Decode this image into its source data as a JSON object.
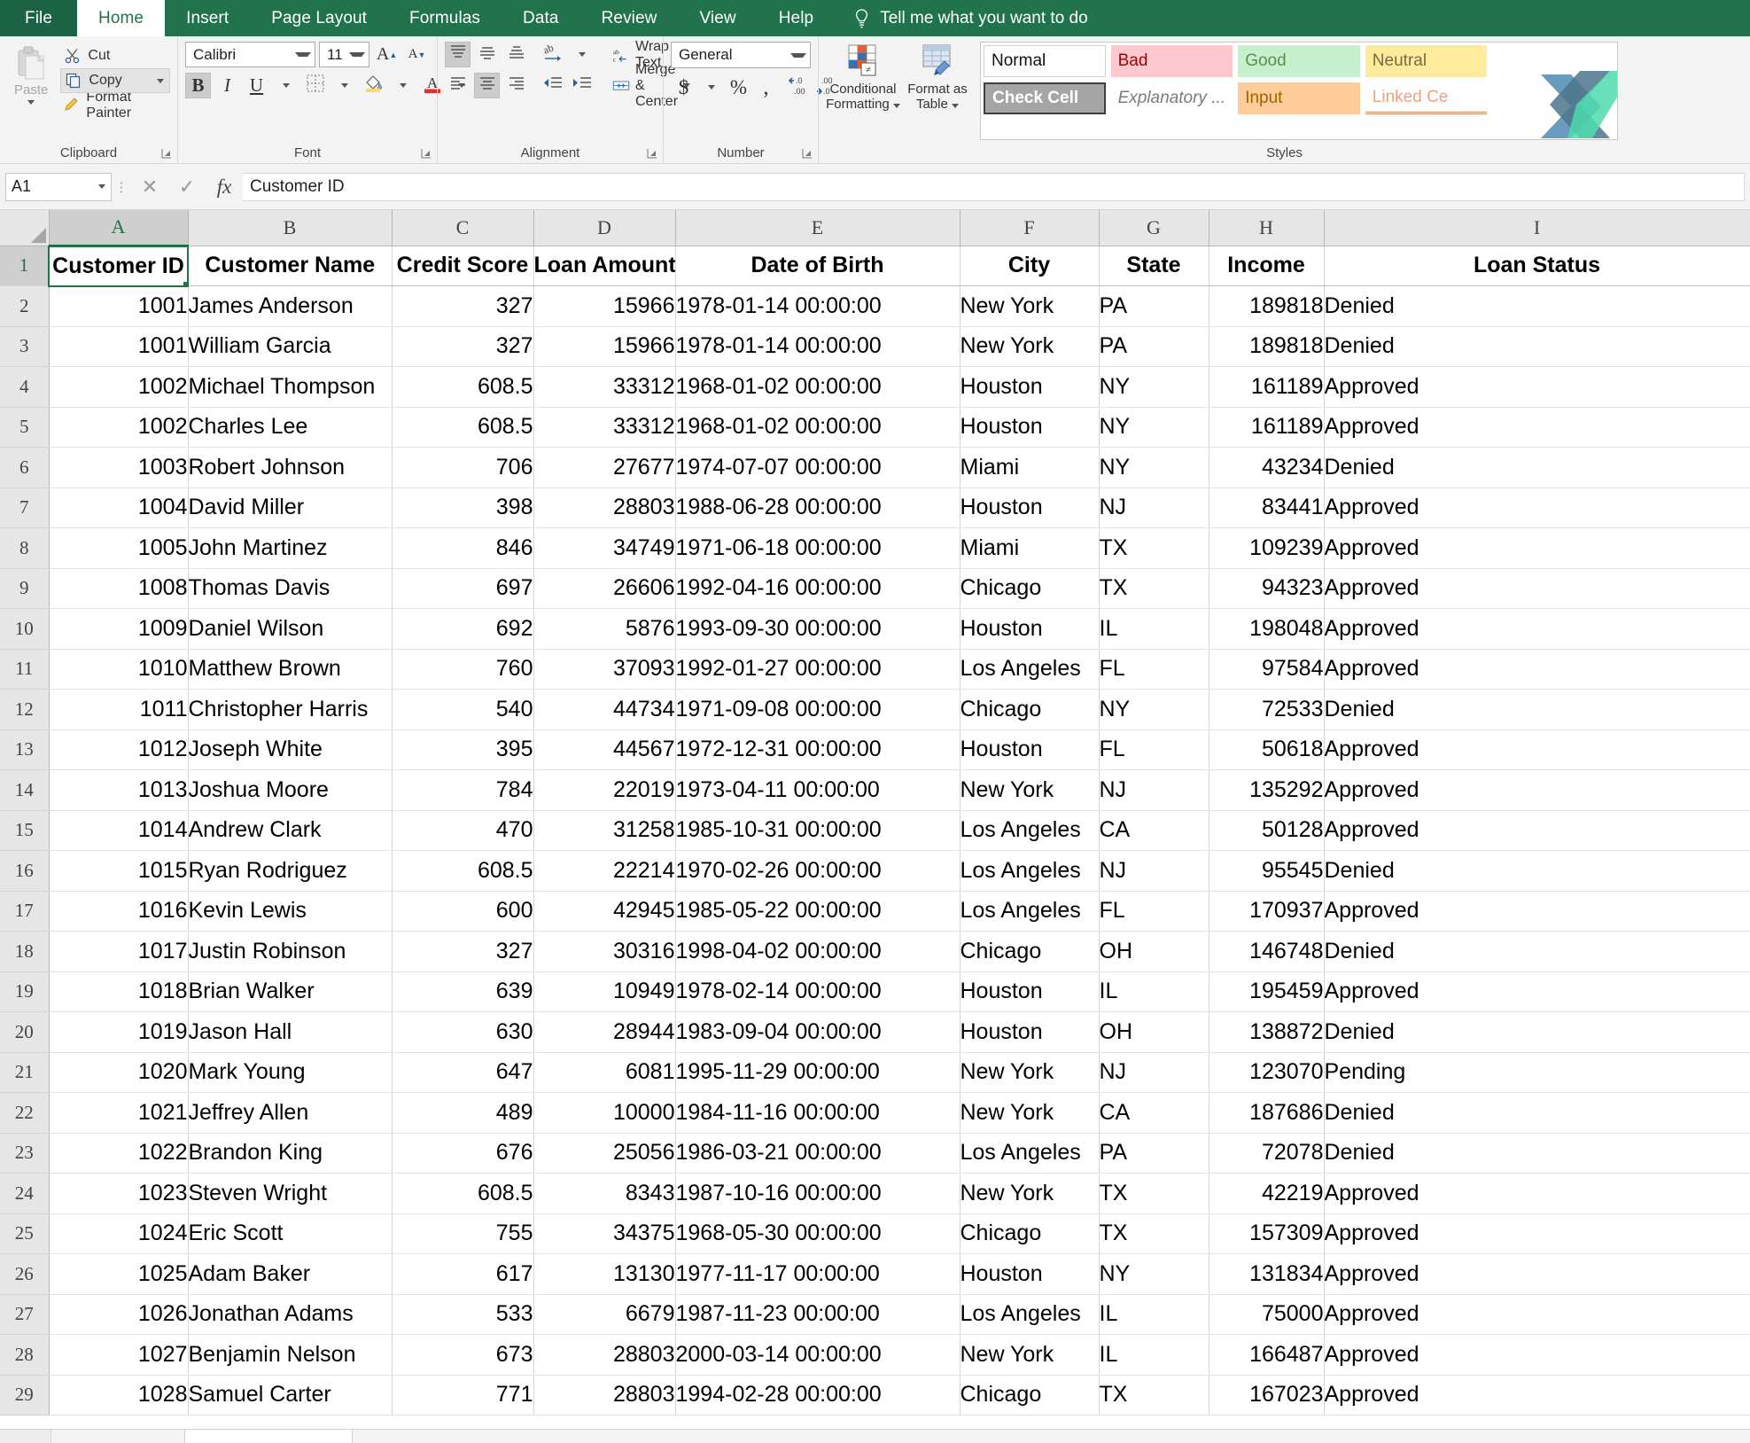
{
  "ribbon": {
    "tabs": [
      {
        "label": "File",
        "id": "file"
      },
      {
        "label": "Home",
        "id": "home"
      },
      {
        "label": "Insert",
        "id": "insert"
      },
      {
        "label": "Page Layout",
        "id": "page-layout"
      },
      {
        "label": "Formulas",
        "id": "formulas"
      },
      {
        "label": "Data",
        "id": "data"
      },
      {
        "label": "Review",
        "id": "review"
      },
      {
        "label": "View",
        "id": "view"
      },
      {
        "label": "Help",
        "id": "help"
      }
    ],
    "tell_me": "Tell me what you want to do",
    "groups": {
      "clipboard": {
        "label": "Clipboard",
        "paste": "Paste",
        "cut": "Cut",
        "copy": "Copy",
        "format_painter": "Format Painter"
      },
      "font": {
        "label": "Font",
        "font_name": "Calibri",
        "font_size": "11",
        "bold": "B",
        "italic": "I",
        "underline": "U"
      },
      "alignment": {
        "label": "Alignment",
        "wrap_text": "Wrap Text",
        "merge_center": "Merge & Center"
      },
      "number": {
        "label": "Number",
        "format": "General",
        "currency": "$",
        "percent": "%",
        "comma": ",",
        "increase_decimal": ".00",
        "decrease_decimal": ".00"
      },
      "styles": {
        "label": "Styles",
        "conditional_formatting": "Conditional Formatting",
        "format_as_table": "Format as Table",
        "gallery": [
          "Normal",
          "Bad",
          "Good",
          "Neutral",
          "",
          "Check Cell",
          "Explanatory ...",
          "Input",
          "Linked Ce",
          ""
        ],
        "gallery_items": {
          "normal": "Normal",
          "bad": "Bad",
          "good": "Good",
          "neutral": "Neutral",
          "check_cell": "Check Cell",
          "explanatory": "Explanatory ...",
          "input": "Input",
          "linked_cell": "Linked Ce"
        }
      }
    }
  },
  "formula_bar": {
    "name_box": "A1",
    "cancel": "✕",
    "enter": "✓",
    "fx": "fx",
    "content": "Customer ID"
  },
  "sheet": {
    "column_letters": [
      "A",
      "B",
      "C",
      "D",
      "E",
      "F",
      "G",
      "H",
      "I"
    ],
    "selected_column": "A",
    "selected_row": 1,
    "active_cell": "A1",
    "row_numbers": [
      1,
      2,
      3,
      4,
      5,
      6,
      7,
      8,
      9,
      10,
      11,
      12,
      13,
      14,
      15,
      16,
      17,
      18,
      19,
      20,
      21,
      22,
      23,
      24,
      25,
      26,
      27,
      28,
      29
    ],
    "headers": [
      "Customer ID",
      "Customer Name",
      "Credit Score",
      "Loan Amount",
      "Date of Birth",
      "City",
      "State",
      "Income",
      "Loan Status"
    ],
    "rows": [
      [
        "1001",
        "James Anderson",
        "327",
        "15966",
        "1978-01-14 00:00:00",
        "New York",
        "PA",
        "189818",
        "Denied"
      ],
      [
        "1001",
        "William Garcia",
        "327",
        "15966",
        "1978-01-14 00:00:00",
        "New York",
        "PA",
        "189818",
        "Denied"
      ],
      [
        "1002",
        "Michael Thompson",
        "608.5",
        "33312",
        "1968-01-02 00:00:00",
        "Houston",
        "NY",
        "161189",
        "Approved"
      ],
      [
        "1002",
        "Charles Lee",
        "608.5",
        "33312",
        "1968-01-02 00:00:00",
        "Houston",
        "NY",
        "161189",
        "Approved"
      ],
      [
        "1003",
        "Robert Johnson",
        "706",
        "27677",
        "1974-07-07 00:00:00",
        "Miami",
        "NY",
        "43234",
        "Denied"
      ],
      [
        "1004",
        "David Miller",
        "398",
        "28803",
        "1988-06-28 00:00:00",
        "Houston",
        "NJ",
        "83441",
        "Approved"
      ],
      [
        "1005",
        "John Martinez",
        "846",
        "34749",
        "1971-06-18 00:00:00",
        "Miami",
        "TX",
        "109239",
        "Approved"
      ],
      [
        "1008",
        "Thomas Davis",
        "697",
        "26606",
        "1992-04-16 00:00:00",
        "Chicago",
        "TX",
        "94323",
        "Approved"
      ],
      [
        "1009",
        "Daniel Wilson",
        "692",
        "5876",
        "1993-09-30 00:00:00",
        "Houston",
        "IL",
        "198048",
        "Approved"
      ],
      [
        "1010",
        "Matthew Brown",
        "760",
        "37093",
        "1992-01-27 00:00:00",
        "Los Angeles",
        "FL",
        "97584",
        "Approved"
      ],
      [
        "1011",
        "Christopher Harris",
        "540",
        "44734",
        "1971-09-08 00:00:00",
        "Chicago",
        "NY",
        "72533",
        "Denied"
      ],
      [
        "1012",
        "Joseph White",
        "395",
        "44567",
        "1972-12-31 00:00:00",
        "Houston",
        "FL",
        "50618",
        "Approved"
      ],
      [
        "1013",
        "Joshua Moore",
        "784",
        "22019",
        "1973-04-11 00:00:00",
        "New York",
        "NJ",
        "135292",
        "Approved"
      ],
      [
        "1014",
        "Andrew Clark",
        "470",
        "31258",
        "1985-10-31 00:00:00",
        "Los Angeles",
        "CA",
        "50128",
        "Approved"
      ],
      [
        "1015",
        "Ryan Rodriguez",
        "608.5",
        "22214",
        "1970-02-26 00:00:00",
        "Los Angeles",
        "NJ",
        "95545",
        "Denied"
      ],
      [
        "1016",
        "Kevin Lewis",
        "600",
        "42945",
        "1985-05-22 00:00:00",
        "Los Angeles",
        "FL",
        "170937",
        "Approved"
      ],
      [
        "1017",
        "Justin Robinson",
        "327",
        "30316",
        "1998-04-02 00:00:00",
        "Chicago",
        "OH",
        "146748",
        "Denied"
      ],
      [
        "1018",
        "Brian Walker",
        "639",
        "10949",
        "1978-02-14 00:00:00",
        "Houston",
        "IL",
        "195459",
        "Approved"
      ],
      [
        "1019",
        "Jason Hall",
        "630",
        "28944",
        "1983-09-04 00:00:00",
        "Houston",
        "OH",
        "138872",
        "Denied"
      ],
      [
        "1020",
        "Mark Young",
        "647",
        "6081",
        "1995-11-29 00:00:00",
        "New York",
        "NJ",
        "123070",
        "Pending"
      ],
      [
        "1021",
        "Jeffrey Allen",
        "489",
        "10000",
        "1984-11-16 00:00:00",
        "New York",
        "CA",
        "187686",
        "Denied"
      ],
      [
        "1022",
        "Brandon King",
        "676",
        "25056",
        "1986-03-21 00:00:00",
        "Los Angeles",
        "PA",
        "72078",
        "Denied"
      ],
      [
        "1023",
        "Steven Wright",
        "608.5",
        "8343",
        "1987-10-16 00:00:00",
        "New York",
        "TX",
        "42219",
        "Approved"
      ],
      [
        "1024",
        "Eric Scott",
        "755",
        "34375",
        "1968-05-30 00:00:00",
        "Chicago",
        "TX",
        "157309",
        "Approved"
      ],
      [
        "1025",
        "Adam Baker",
        "617",
        "13130",
        "1977-11-17 00:00:00",
        "Houston",
        "NY",
        "131834",
        "Approved"
      ],
      [
        "1026",
        "Jonathan Adams",
        "533",
        "6679",
        "1987-11-23 00:00:00",
        "Los Angeles",
        "IL",
        "75000",
        "Approved"
      ],
      [
        "1027",
        "Benjamin Nelson",
        "673",
        "28803",
        "2000-03-14 00:00:00",
        "New York",
        "IL",
        "166487",
        "Approved"
      ],
      [
        "1028",
        "Samuel Carter",
        "771",
        "28803",
        "1994-02-28 00:00:00",
        "Chicago",
        "TX",
        "167023",
        "Approved"
      ]
    ],
    "column_alignment": [
      "num",
      "txt",
      "num",
      "num",
      "txt",
      "txt",
      "txt",
      "num",
      "txt"
    ]
  },
  "colors": {
    "ribbon_green": "#21734d",
    "accent_green": "#217346",
    "bad_bg": "#ffc7ce",
    "good_bg": "#c6efce",
    "neutral_bg": "#ffeb9c",
    "input_bg": "#ffcc99",
    "check_bg": "#a5a5a5"
  }
}
